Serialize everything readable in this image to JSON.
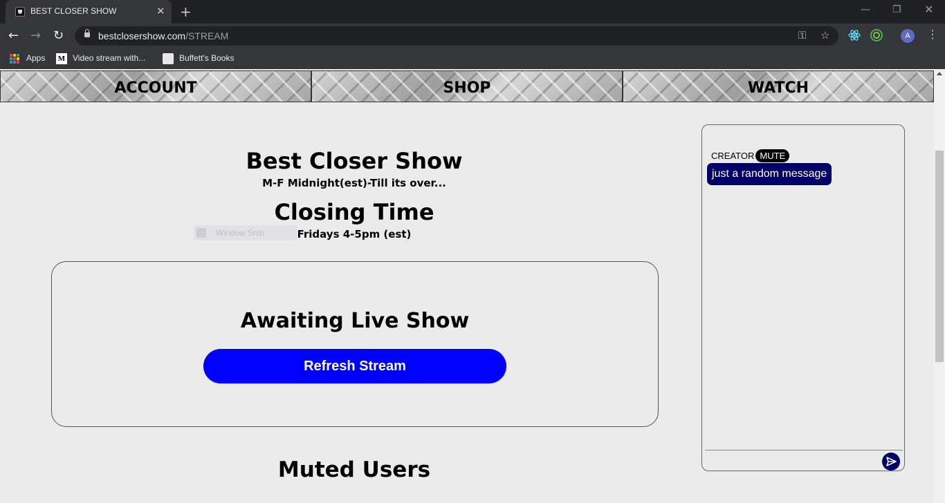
{
  "browser": {
    "tab_title": "BEST CLOSER SHOW",
    "tab_close": "✕",
    "new_tab": "+",
    "url_host": "bestclosershow.com",
    "url_path": "/STREAM",
    "bookmarks": [
      "Apps",
      "Video stream with...",
      "Buffett's Books"
    ],
    "avatar_letter": "A",
    "window_controls": [
      "—",
      "❐",
      "✕"
    ]
  },
  "nav": {
    "items": [
      "ACCOUNT",
      "SHOP",
      "WATCH"
    ]
  },
  "show": {
    "title": "Best Closer Show",
    "schedule": "M-F Midnight(est)-Till its over...",
    "segment_title": "Closing Time",
    "segment_schedule": "Fridays 4-5pm (est)",
    "ghost_label": "Window Snip"
  },
  "stream": {
    "status": "Awaiting Live Show",
    "refresh_label": "Refresh Stream",
    "button_color": "#0000ff"
  },
  "muted": {
    "title": "Muted Users"
  },
  "chat": {
    "messages": [
      {
        "user": "CREATOR",
        "action": "MUTE",
        "text": "just a random message"
      }
    ],
    "bubble_color": "#000066",
    "input_placeholder": ""
  }
}
